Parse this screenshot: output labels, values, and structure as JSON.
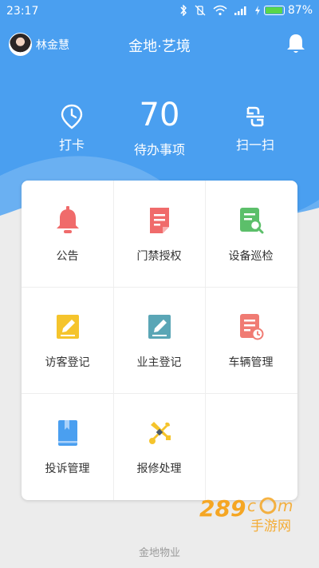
{
  "status_bar": {
    "time": "23:17",
    "battery": "87%",
    "battery_level": 0.87,
    "icons": [
      "bluetooth-icon",
      "vibrate-off-icon",
      "wifi-icon",
      "signal-icon",
      "battery-icon"
    ]
  },
  "header": {
    "username": "林金慧",
    "title": "金地·艺境"
  },
  "stats": {
    "punch_label": "打卡",
    "todo_count": "70",
    "todo_label": "待办事项",
    "scan_label": "扫一扫"
  },
  "grid": {
    "items": [
      {
        "label": "公告",
        "icon": "bell-icon",
        "color": "#f06b6b"
      },
      {
        "label": "门禁授权",
        "icon": "document-icon",
        "color": "#f06b6b"
      },
      {
        "label": "设备巡检",
        "icon": "inspection-icon",
        "color": "#5cbf6a"
      },
      {
        "label": "访客登记",
        "icon": "edit-icon",
        "color": "#f5c42c"
      },
      {
        "label": "业主登记",
        "icon": "edit-icon",
        "color": "#5aa6b6"
      },
      {
        "label": "车辆管理",
        "icon": "vehicle-record-icon",
        "color": "#f07b73"
      },
      {
        "label": "投诉管理",
        "icon": "complaint-book-icon",
        "color": "#4a9ff0"
      },
      {
        "label": "报修处理",
        "icon": "repair-tools-icon",
        "color": "#f5c42c"
      }
    ]
  },
  "footer": {
    "company": "金地物业"
  },
  "watermark": {
    "text": "手游网",
    "brand": "289.com"
  },
  "colors": {
    "primary": "#4a9ff0",
    "background": "#ececec"
  }
}
